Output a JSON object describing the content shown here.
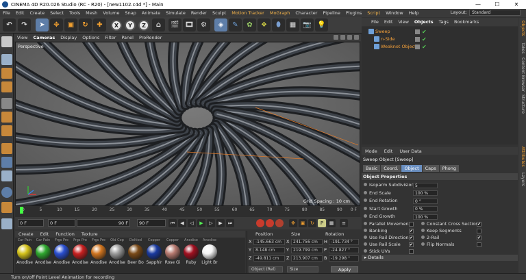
{
  "window": {
    "title": "CINEMA 4D R20.026 Studio (RC - R20) - [new1102.c4d *] - Main",
    "controls": [
      "—",
      "☐",
      "✕"
    ]
  },
  "menubar": {
    "items": [
      "File",
      "Edit",
      "Create",
      "Select",
      "Tools",
      "Mesh",
      "Volume",
      "Snap",
      "Animate",
      "Simulate",
      "Render",
      "Sculpt",
      "Motion Tracker",
      "MoGraph",
      "Character",
      "Pipeline",
      "Plugins",
      "Script",
      "Window",
      "Help"
    ],
    "layout_label": "Layout:",
    "layout_value": "Standard"
  },
  "toolbar": {
    "x_label": "X",
    "y_label": "Y",
    "z_label": "Z"
  },
  "viewport": {
    "menu": [
      "View",
      "Cameras",
      "Display",
      "Options",
      "Filter",
      "Panel",
      "ProRender"
    ],
    "label": "Perspective",
    "grid_spacing": "Grid Spacing : 10 cm"
  },
  "timeline": {
    "ticks": [
      "0",
      "5",
      "10",
      "15",
      "20",
      "25",
      "30",
      "35",
      "40",
      "45",
      "50",
      "55",
      "60",
      "65",
      "70",
      "75",
      "80",
      "85",
      "90"
    ],
    "frame_end": "0 F"
  },
  "transport": {
    "current_frame": "0 F",
    "start_frame": "0 F",
    "end_frame_a": "90 F",
    "end_frame_b": "90 F"
  },
  "materials": {
    "menu": [
      "Create",
      "Edit",
      "Function",
      "Texture"
    ],
    "items": [
      {
        "top": "Car Pain",
        "name": "Anodise",
        "color": "#d4c21a"
      },
      {
        "top": "Car Pain",
        "name": "Anodise",
        "color": "#2fa82f"
      },
      {
        "top": "Frgs Pre",
        "name": "Anodise",
        "color": "#2a4fd0"
      },
      {
        "top": "Frgs Pre",
        "name": "Anodise",
        "color": "#c82020"
      },
      {
        "top": "Frgs Pre",
        "name": "Anodise",
        "color": "#d07520"
      },
      {
        "top": "Old Cop",
        "name": "Anodise",
        "color": "#9a9a9a"
      },
      {
        "top": "Deltied",
        "name": "Beer Bo",
        "color": "#7a4a18"
      },
      {
        "top": "Copper",
        "name": "Sapphir",
        "color": "#1a3aa0"
      },
      {
        "top": "Copper",
        "name": "Rose Gi",
        "color": "#b77a70"
      },
      {
        "top": "Anodise",
        "name": "Ruby",
        "color": "#a01020"
      },
      {
        "top": "Anodise",
        "name": "Light Br",
        "color": "#f4f4f4"
      }
    ]
  },
  "coordinates": {
    "headers": [
      "Position",
      "Size",
      "Rotation"
    ],
    "rows": [
      {
        "axis": "X",
        "pos": "-145.663 cm",
        "size": "241.756 cm",
        "rot_label": "H",
        "rot": "-191.734 °"
      },
      {
        "axis": "Y",
        "pos": "8.148 cm",
        "size": "219.799 cm",
        "rot_label": "P",
        "rot": "-24.827 °"
      },
      {
        "axis": "Z",
        "pos": "-49.811 cm",
        "size": "213.907 cm",
        "rot_label": "B",
        "rot": "-19.298 °"
      }
    ],
    "mode": "Object (Rel)",
    "size_mode": "Size",
    "apply": "Apply"
  },
  "objects": {
    "menu": [
      "File",
      "Edit",
      "View",
      "Objects",
      "Tags",
      "Bookmarks"
    ],
    "items": [
      {
        "name": "Sweep",
        "indent": 0,
        "icon_color": "#6fa0d8"
      },
      {
        "name": "n-Side",
        "indent": 1,
        "icon_color": "#6fa0d8"
      },
      {
        "name": "Weaknot Object",
        "indent": 1,
        "icon_color": "#6fa0d8"
      }
    ]
  },
  "attributes": {
    "menu": [
      "Mode",
      "Edit",
      "User Data"
    ],
    "title": "Sweep Object [Sweep]",
    "tabs": [
      "Basic",
      "Coord.",
      "Object",
      "Caps",
      "Phong"
    ],
    "active_tab": "Object",
    "section": "Object Properties",
    "fields": [
      {
        "label": "Isoparm Subdivision",
        "value": "5"
      },
      {
        "label": "End Scale",
        "value": "100 %"
      },
      {
        "label": "End Rotation",
        "value": "0 °"
      },
      {
        "label": "Start Growth",
        "value": "0 %"
      },
      {
        "label": "End Growth",
        "value": "100 %"
      }
    ],
    "checks_left": [
      {
        "label": "Parallel Movement",
        "checked": false
      },
      {
        "label": "Banking",
        "checked": true
      },
      {
        "label": "Use Rail Direction",
        "checked": true
      },
      {
        "label": "Use Rail Scale",
        "checked": true
      },
      {
        "label": "Stick UVs",
        "checked": false
      }
    ],
    "checks_right": [
      {
        "label": "Constant Cross Section",
        "checked": true
      },
      {
        "label": "Keep Segments",
        "checked": false
      },
      {
        "label": "2-Rail",
        "checked": true
      },
      {
        "label": "Flip Normals",
        "checked": false
      }
    ],
    "details": "Details"
  },
  "right_tabs": [
    "Objects",
    "Takes",
    "Content Browser",
    "Structure",
    "Attributes",
    "Layers"
  ],
  "statusbar": {
    "text": "Turn on/off Point Level Animation for recording"
  }
}
